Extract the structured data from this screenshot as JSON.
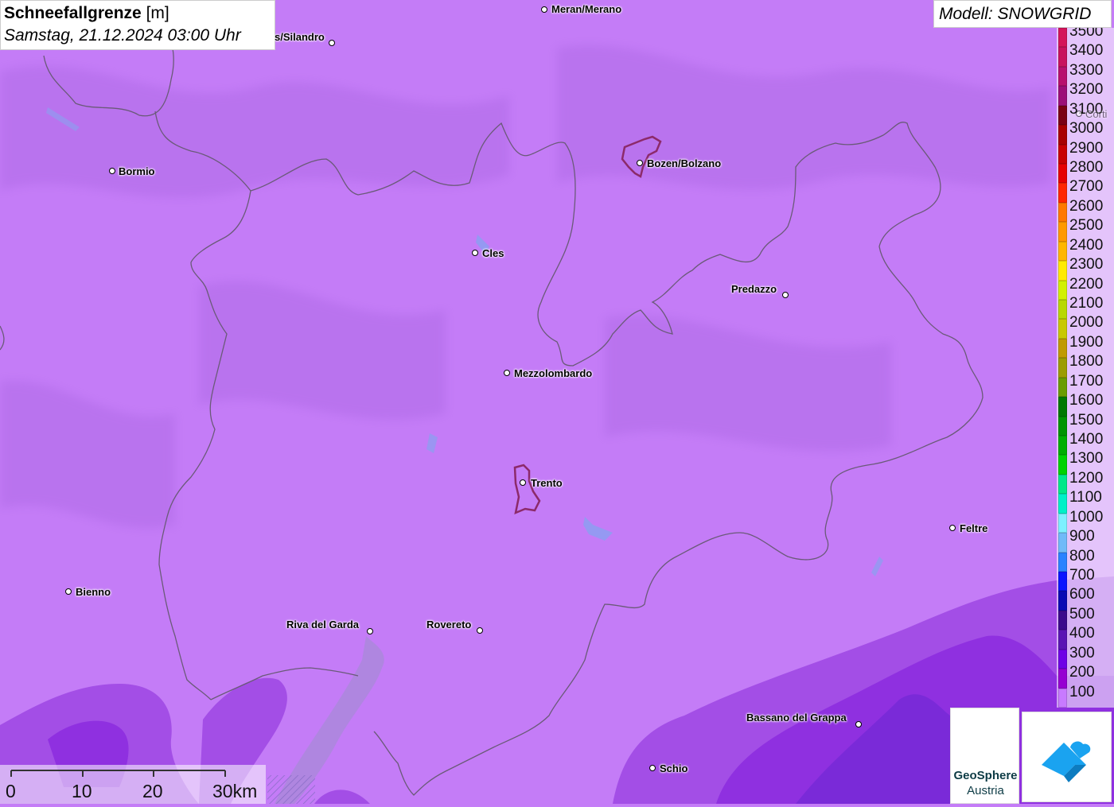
{
  "header": {
    "title_bold": "Schneefallgrenze",
    "title_unit": "[m]",
    "datetime": "Samstag, 21.12.2024 03:00 Uhr"
  },
  "model_label": "Modell: SNOWGRID",
  "legend": {
    "items": [
      {
        "label": "3500",
        "color": "#d4145a"
      },
      {
        "label": "3400",
        "color": "#c8125e"
      },
      {
        "label": "3300",
        "color": "#b7106e"
      },
      {
        "label": "3200",
        "color": "#9c0e78"
      },
      {
        "label": "3100",
        "color": "#7a0014"
      },
      {
        "label": "3000",
        "color": "#a80000"
      },
      {
        "label": "2900",
        "color": "#c80000"
      },
      {
        "label": "2800",
        "color": "#e60000"
      },
      {
        "label": "2700",
        "color": "#ff2600"
      },
      {
        "label": "2600",
        "color": "#ff7800"
      },
      {
        "label": "2500",
        "color": "#ff9900"
      },
      {
        "label": "2400",
        "color": "#ffb600"
      },
      {
        "label": "2300",
        "color": "#ffea00"
      },
      {
        "label": "2200",
        "color": "#d2f000"
      },
      {
        "label": "2100",
        "color": "#b8d800"
      },
      {
        "label": "2000",
        "color": "#c8c800"
      },
      {
        "label": "1900",
        "color": "#c09a00"
      },
      {
        "label": "1800",
        "color": "#9c9c00"
      },
      {
        "label": "1700",
        "color": "#6a9c00"
      },
      {
        "label": "1600",
        "color": "#007800"
      },
      {
        "label": "1500",
        "color": "#009400"
      },
      {
        "label": "1400",
        "color": "#00ae00"
      },
      {
        "label": "1300",
        "color": "#00d200"
      },
      {
        "label": "1200",
        "color": "#00e88a"
      },
      {
        "label": "1100",
        "color": "#00f0c8"
      },
      {
        "label": "1000",
        "color": "#7ef0ff"
      },
      {
        "label": "900",
        "color": "#70baf8"
      },
      {
        "label": "800",
        "color": "#2a82ff"
      },
      {
        "label": "700",
        "color": "#0a14ff"
      },
      {
        "label": "600",
        "color": "#0a0ab4"
      },
      {
        "label": "500",
        "color": "#3c0a8c"
      },
      {
        "label": "400",
        "color": "#5a14b4"
      },
      {
        "label": "300",
        "color": "#6e00e6"
      },
      {
        "label": "200",
        "color": "#9600d2"
      },
      {
        "label": "100",
        "color": "#c87aff"
      }
    ]
  },
  "scalebar": {
    "labels": [
      "0",
      "10",
      "20",
      "30km"
    ]
  },
  "cities": [
    {
      "name": "Meran/Merano"
    },
    {
      "name": "s/Silandro"
    },
    {
      "name": "Bormio"
    },
    {
      "name": "Bozen/Bolzano"
    },
    {
      "name": "Cles"
    },
    {
      "name": "Predazzo"
    },
    {
      "name": "Mezzolombardo"
    },
    {
      "name": "Trento"
    },
    {
      "name": "Feltre"
    },
    {
      "name": "Bienno"
    },
    {
      "name": "Riva del Garda"
    },
    {
      "name": "Rovereto"
    },
    {
      "name": "Bassano del Grappa"
    },
    {
      "name": "Schio"
    },
    {
      "name": "Corti"
    }
  ],
  "logos": {
    "geosphere_line1": "GeoSphere",
    "geosphere_line2": "Austria"
  },
  "colors": {
    "map_base": "#c47cf7",
    "low_snowline": "#9d2fe0",
    "lowest_snowline": "#7a2ad8",
    "border": "#6a5a78",
    "city_highlight": "#8c2a6a",
    "logo_blue": "#1aa3f0"
  }
}
